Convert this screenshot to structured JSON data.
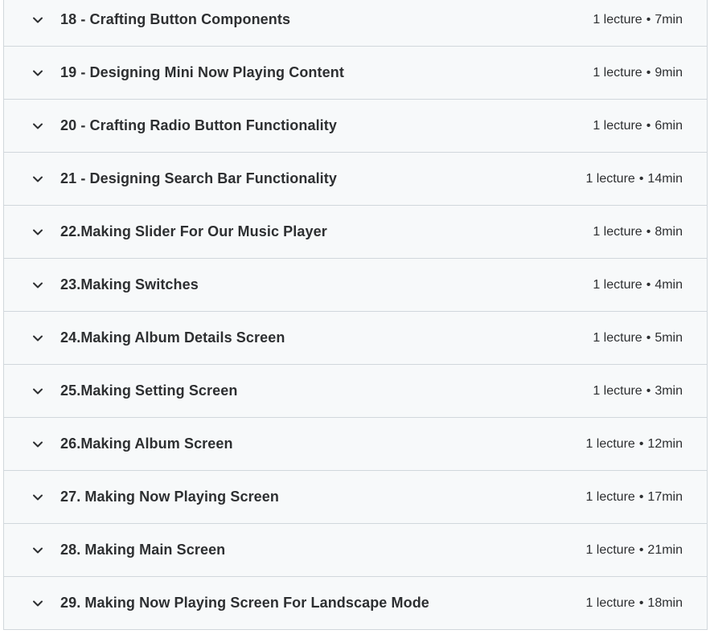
{
  "sections": [
    {
      "title": "18 - Crafting Button Components",
      "lectures": "1 lecture",
      "duration": "7min"
    },
    {
      "title": "19 - Designing Mini Now Playing Content",
      "lectures": "1 lecture",
      "duration": "9min"
    },
    {
      "title": "20 - Crafting Radio Button Functionality",
      "lectures": "1 lecture",
      "duration": "6min"
    },
    {
      "title": "21 - Designing Search Bar Functionality",
      "lectures": "1 lecture",
      "duration": "14min"
    },
    {
      "title": "22.Making Slider For Our Music Player",
      "lectures": "1 lecture",
      "duration": "8min"
    },
    {
      "title": "23.Making Switches",
      "lectures": "1 lecture",
      "duration": "4min"
    },
    {
      "title": "24.Making Album Details Screen",
      "lectures": "1 lecture",
      "duration": "5min"
    },
    {
      "title": "25.Making Setting Screen",
      "lectures": "1 lecture",
      "duration": "3min"
    },
    {
      "title": "26.Making Album Screen",
      "lectures": "1 lecture",
      "duration": "12min"
    },
    {
      "title": "27. Making Now Playing Screen",
      "lectures": "1 lecture",
      "duration": "17min"
    },
    {
      "title": "28. Making Main Screen",
      "lectures": "1 lecture",
      "duration": "21min"
    },
    {
      "title": "29. Making Now Playing Screen For Landscape Mode",
      "lectures": "1 lecture",
      "duration": "18min"
    }
  ],
  "separator": "•",
  "icons": {
    "expand": "chevron-down-icon"
  },
  "colors": {
    "text": "#2d2f31",
    "row_bg": "#f7f9fa",
    "border": "#d1d7dc"
  }
}
